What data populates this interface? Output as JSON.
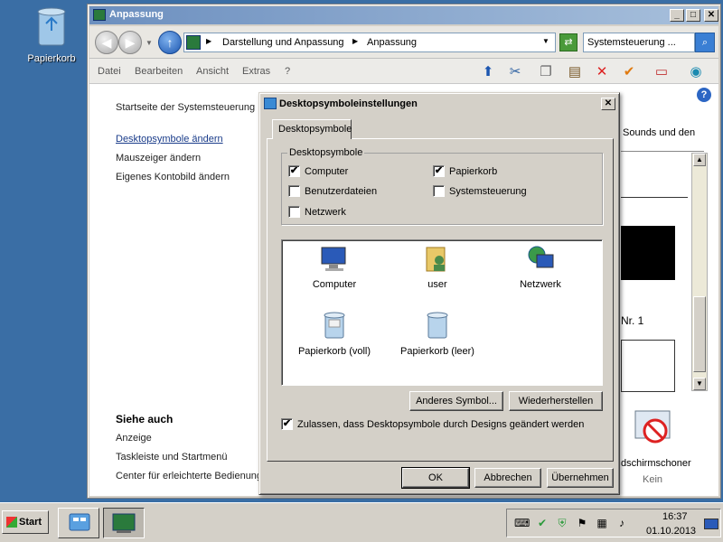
{
  "desktop": {
    "recycle_label": "Papierkorb"
  },
  "window": {
    "title": "Anpassung",
    "address": {
      "part1": "Darstellung und Anpassung",
      "part2": "Anpassung"
    },
    "search_text": "Systemsteuerung ...",
    "menu": [
      "Datei",
      "Bearbeiten",
      "Ansicht",
      "Extras",
      "?"
    ],
    "left_links": {
      "home": "Startseite der Systemsteuerung",
      "desktop_icons": "Desktopsymbole ändern",
      "mouse": "Mauszeiger ändern",
      "account": "Eigenes Kontobild ändern"
    },
    "see_also": {
      "heading": "Siehe auch",
      "display": "Anzeige",
      "taskbar": "Taskleiste und Startmenü",
      "ease": "Center für erleichterte Bedienung"
    },
    "right_fragments": {
      "sounds": "Sounds und den",
      "nr": "Nr. 1",
      "screensaver": "dschirmschoner",
      "screensaver_value": "Kein"
    }
  },
  "dialog": {
    "title": "Desktopsymboleinstellungen",
    "tab": "Desktopsymbole",
    "group_label": "Desktopsymbole",
    "checks": [
      {
        "label": "Computer",
        "checked": "✔"
      },
      {
        "label": "Papierkorb",
        "checked": "✔"
      },
      {
        "label": "Benutzerdateien",
        "checked": ""
      },
      {
        "label": "Systemsteuerung",
        "checked": ""
      },
      {
        "label": "Netzwerk",
        "checked": ""
      }
    ],
    "icons": [
      "Computer",
      "user",
      "Netzwerk",
      "Papierkorb (voll)",
      "Papierkorb (leer)"
    ],
    "btn_other": "Anderes Symbol...",
    "btn_restore": "Wiederherstellen",
    "allow_label": "Zulassen, dass Desktopsymbole durch Designs geändert werden",
    "allow_checked": "✔",
    "ok": "OK",
    "cancel": "Abbrechen",
    "apply": "Übernehmen"
  },
  "taskbar": {
    "start": "Start",
    "time": "16:37",
    "date": "01.10.2013"
  }
}
